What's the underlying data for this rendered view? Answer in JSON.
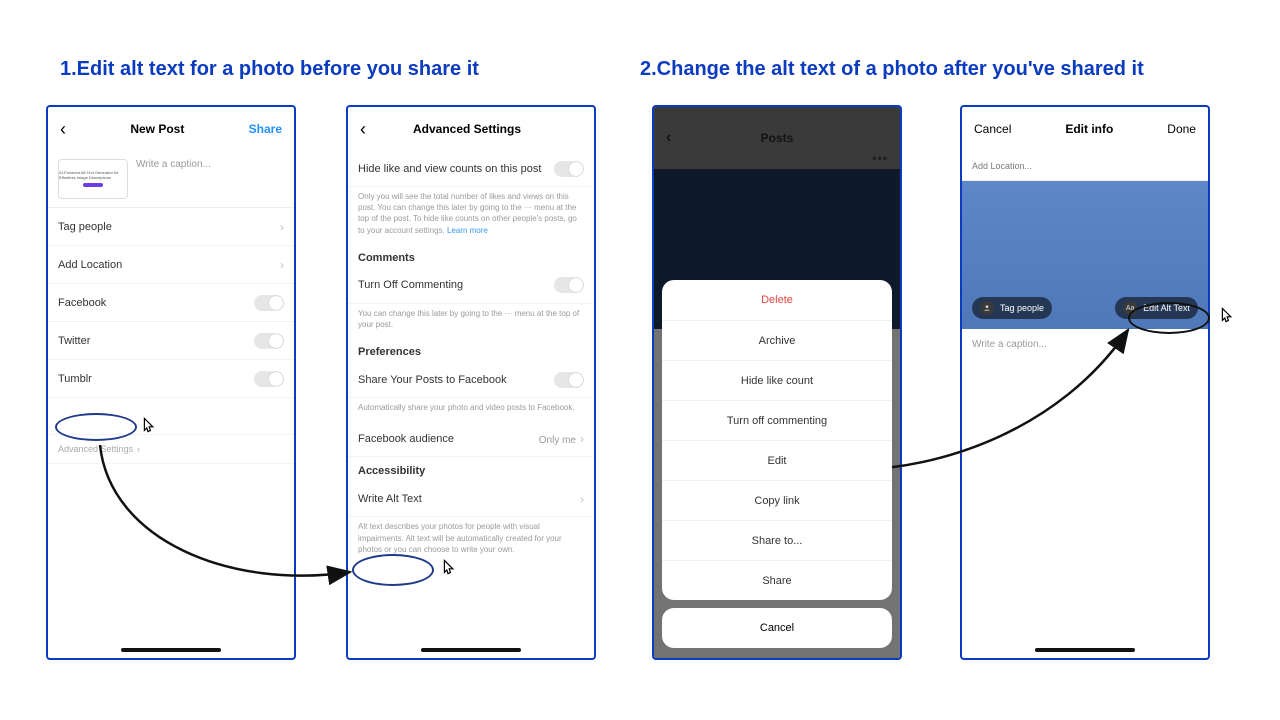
{
  "headings": {
    "h1": "1.Edit alt text for a photo before you share it",
    "h2": "2.Change the alt text of a photo after you've shared it"
  },
  "phone1": {
    "title": "New Post",
    "share": "Share",
    "thumb_line": "AI-Powered Alt Text Generator for Effortless Image Descriptions",
    "caption_placeholder": "Write a caption...",
    "rows": {
      "tag": "Tag people",
      "loc": "Add Location",
      "fb": "Facebook",
      "tw": "Twitter",
      "tb": "Tumblr"
    },
    "advanced": "Advanced Settings"
  },
  "phone2": {
    "title": "Advanced Settings",
    "hide": "Hide like and view counts on this post",
    "hide_note": "Only you will see the total number of likes and views on this post. You can change this later by going to the ··· menu at the top of the post. To hide like counts on other people's posts, go to your account settings. ",
    "learn_more": "Learn more",
    "comments": "Comments",
    "turn_off": "Turn Off Commenting",
    "turn_off_note": "You can change this later by going to the ··· menu at the top of your post.",
    "prefs": "Preferences",
    "share_fb": "Share Your Posts to Facebook",
    "share_fb_note": "Automatically share your photo and video posts to Facebook.",
    "fb_aud": "Facebook audience",
    "fb_aud_val": "Only me",
    "access": "Accessibility",
    "write_alt": "Write Alt Text",
    "write_alt_note": "Alt text describes your photos for people with visual impairments. Alt text will be automatically created for your photos or you can choose to write your own."
  },
  "phone3": {
    "title": "Posts",
    "opts": {
      "delete": "Delete",
      "archive": "Archive",
      "hide": "Hide like count",
      "turn_off": "Turn off commenting",
      "edit": "Edit",
      "copy": "Copy link",
      "share_to": "Share to...",
      "share": "Share"
    },
    "cancel": "Cancel"
  },
  "phone4": {
    "cancel": "Cancel",
    "title": "Edit info",
    "done": "Done",
    "add_loc": "Add Location...",
    "tag": "Tag people",
    "edit_alt": "Edit Alt Text",
    "caption_placeholder": "Write a caption..."
  }
}
